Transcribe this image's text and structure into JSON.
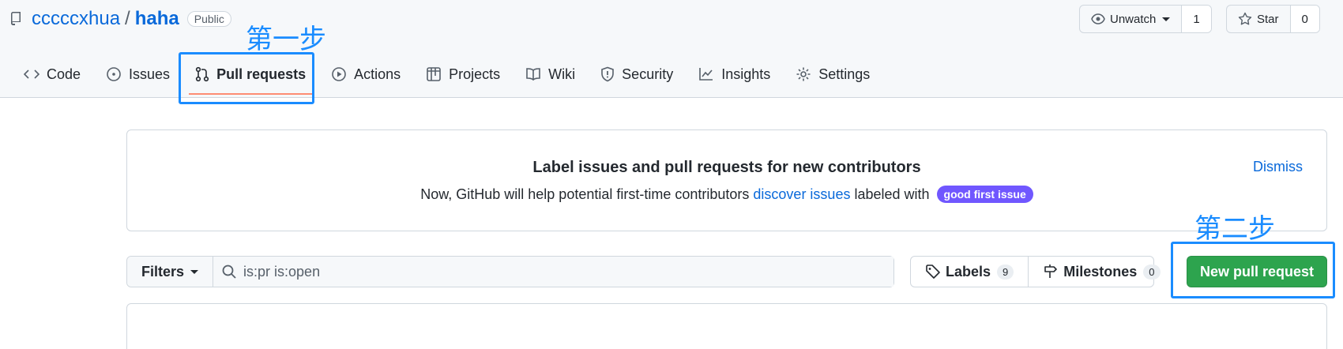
{
  "repo": {
    "owner": "cccccxhua",
    "separator": "/",
    "name": "haha",
    "visibility": "Public"
  },
  "watch": {
    "label": "Unwatch",
    "count": "1"
  },
  "star": {
    "label": "Star",
    "count": "0"
  },
  "nav": [
    {
      "label": "Code",
      "icon": "code-icon"
    },
    {
      "label": "Issues",
      "icon": "issue-icon"
    },
    {
      "label": "Pull requests",
      "icon": "pull-request-icon",
      "active": true
    },
    {
      "label": "Actions",
      "icon": "play-icon"
    },
    {
      "label": "Projects",
      "icon": "table-icon"
    },
    {
      "label": "Wiki",
      "icon": "book-icon"
    },
    {
      "label": "Security",
      "icon": "shield-icon"
    },
    {
      "label": "Insights",
      "icon": "graph-icon"
    },
    {
      "label": "Settings",
      "icon": "gear-icon"
    }
  ],
  "annotations": {
    "step1": "第一步",
    "step2": "第二步",
    "color": "#1a8cff"
  },
  "banner": {
    "title": "Label issues and pull requests for new contributors",
    "text_before": "Now, GitHub will help potential first-time contributors ",
    "link": "discover issues",
    "text_after": " labeled with ",
    "label": "good first issue",
    "label_color": "#7057ff",
    "dismiss": "Dismiss"
  },
  "filters": {
    "label": "Filters",
    "query": "is:pr is:open"
  },
  "labels": {
    "label": "Labels",
    "count": "9"
  },
  "milestones": {
    "label": "Milestones",
    "count": "0"
  },
  "new_pr": {
    "label": "New pull request",
    "color": "#2da44e"
  }
}
